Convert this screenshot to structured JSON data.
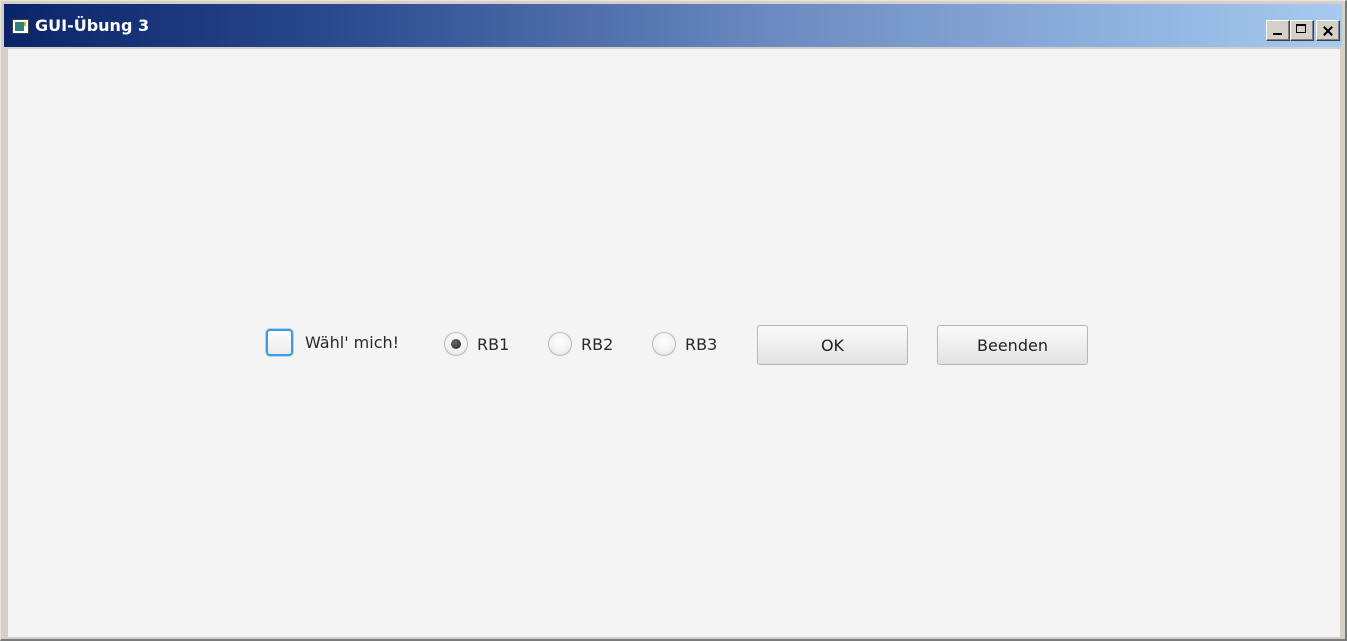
{
  "window": {
    "title": "GUI-Übung 3",
    "buttons": {
      "minimize": "minimize",
      "maximize": "maximize",
      "close": "close"
    }
  },
  "form": {
    "checkbox": {
      "label": "Wähl' mich!",
      "checked": false
    },
    "radios": [
      {
        "label": "RB1",
        "checked": true
      },
      {
        "label": "RB2",
        "checked": false
      },
      {
        "label": "RB3",
        "checked": false
      }
    ],
    "ok_label": "OK",
    "quit_label": "Beenden"
  },
  "colors": {
    "titlebar_start": "#0a246a",
    "titlebar_end": "#a6caf0",
    "client_background": "#f4f4f4",
    "checkbox_focus": "#3c9be0"
  },
  "icons": {
    "app": "app-window-icon",
    "minimize": "minimize-icon",
    "maximize": "maximize-icon",
    "close": "close-icon"
  }
}
